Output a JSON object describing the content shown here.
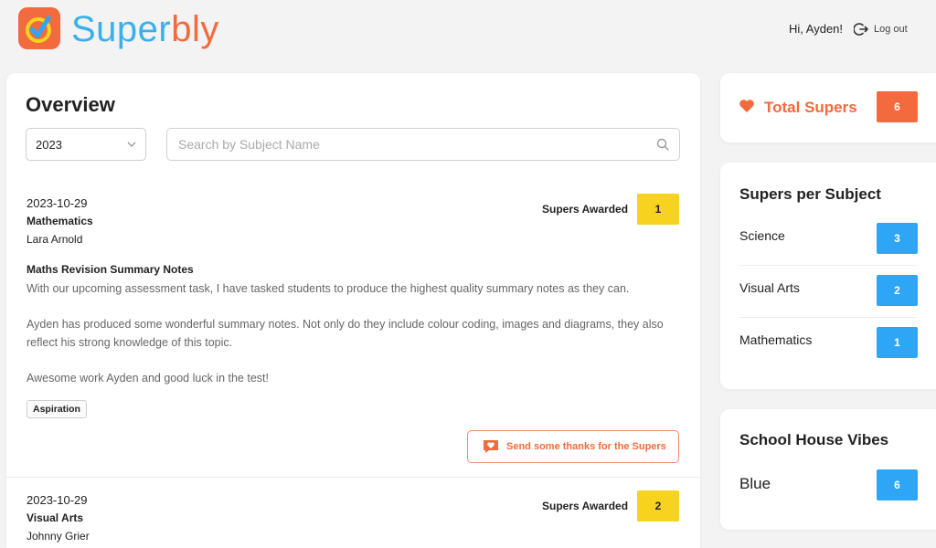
{
  "header": {
    "logo_text_part1": "Super",
    "logo_text_part2": "bly",
    "greeting": "Hi, Ayden!",
    "logout_label": "Log out"
  },
  "overview": {
    "title": "Overview",
    "year_select": {
      "selected": "2023"
    },
    "search": {
      "placeholder": "Search by Subject Name",
      "value": ""
    },
    "supers_awarded_label": "Supers Awarded",
    "entries": [
      {
        "date": "2023-10-29",
        "subject": "Mathematics",
        "teacher": "Lara Arnold",
        "supers": "1",
        "note_title": "Maths Revision Summary Notes",
        "note_paragraphs": [
          "With our upcoming assessment task, I have tasked students to produce the highest quality summary notes as they can.",
          "Ayden has produced some wonderful summary notes. Not only do they include colour coding, images and diagrams, they also reflect his strong knowledge of this topic.",
          "Awesome work Ayden and good luck in the test!"
        ],
        "tag": "Aspiration",
        "thanks_label": "Send some thanks for the Supers"
      },
      {
        "date": "2023-10-29",
        "subject": "Visual Arts",
        "teacher": "Johnny Grier",
        "supers": "2"
      }
    ]
  },
  "total_supers": {
    "label": "Total Supers",
    "value": "6"
  },
  "supers_per_subject": {
    "title": "Supers per Subject",
    "rows": [
      {
        "name": "Science",
        "count": "3"
      },
      {
        "name": "Visual Arts",
        "count": "2"
      },
      {
        "name": "Mathematics",
        "count": "1"
      }
    ]
  },
  "house": {
    "title": "School House Vibes",
    "name": "Blue",
    "value": "6"
  },
  "colors": {
    "brand_orange": "#f26a3d",
    "brand_blue": "#3ab0ea",
    "badge_yellow": "#f7d21e",
    "badge_blue": "#2ea6f5"
  }
}
